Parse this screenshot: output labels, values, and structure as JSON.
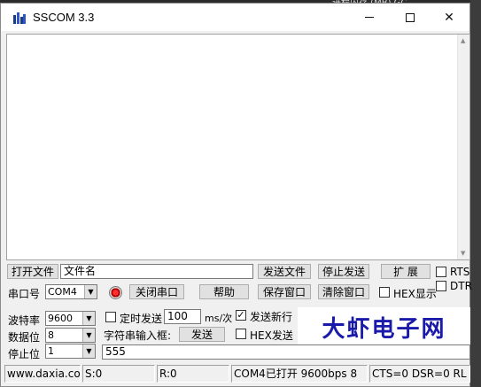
{
  "window": {
    "title": "SSCOM 3.3",
    "buttons": {
      "min": "—",
      "max": "□",
      "close": "✕"
    }
  },
  "background": {
    "tab_text": "进程内存 (MB)   GC"
  },
  "row1": {
    "open_file": "打开文件",
    "file_name": "文件名",
    "send_file": "发送文件",
    "stop_send": "停止发送",
    "expand": "扩 展",
    "rts": "RTS",
    "dtr": "DTR"
  },
  "row2": {
    "port_label": "串口号",
    "port_value": "COM4",
    "close_port": "关闭串口",
    "help": "帮助",
    "save_window": "保存窗口",
    "clear_window": "清除窗口",
    "hex_display": "HEX显示"
  },
  "settings": {
    "baud_label": "波特率",
    "baud_value": "9600",
    "databits_label": "数据位",
    "databits_value": "8",
    "stopbits_label": "停止位",
    "stopbits_value": "1",
    "timed_send": "定时发送",
    "interval": "100",
    "interval_unit": "ms/次",
    "send_newline": "发送新行",
    "input_label": "字符串输入框:",
    "send": "发送",
    "hex_send": "HEX发送",
    "input_value": "555"
  },
  "logo": "大虾电子网",
  "status": {
    "site": "www.daxia.cor",
    "s": "S:0",
    "r": "R:0",
    "port_status": "COM4已打开  9600bps  8",
    "lines": "CTS=0 DSR=0 RL"
  },
  "colors": {
    "logo": "#1a1aaa",
    "led": "#ff3030"
  }
}
